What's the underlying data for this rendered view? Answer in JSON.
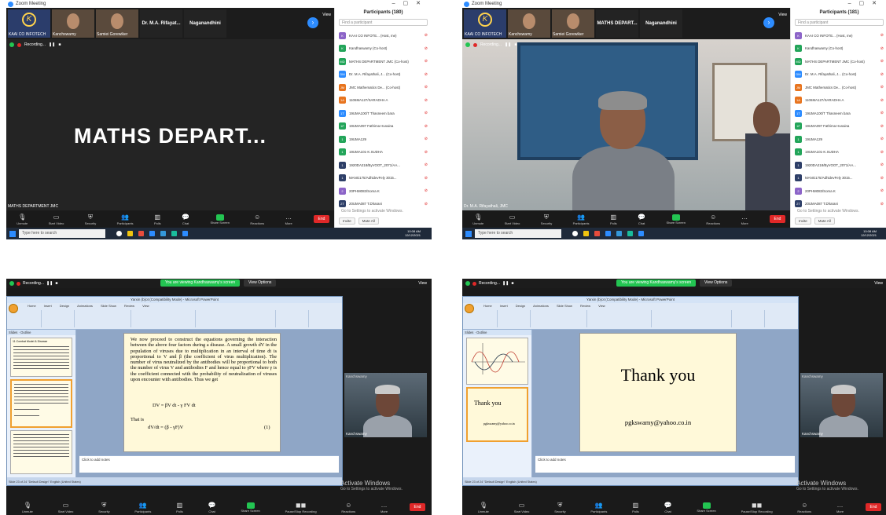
{
  "window_title": "Zoom Meeting",
  "participant_strip": {
    "tiles": [
      "KAAI CO INFOTECH",
      "Kanchswamy",
      "Samiei Gorewiker",
      "Dr. M.A. Rifayat...",
      "Naganandhini"
    ],
    "tiles_q2": [
      "KAAI CO INFOTECH",
      "Kanchswamy",
      "Samiei Gorewiker",
      "MATHS DEPART...",
      "Naganandhini"
    ]
  },
  "view_label": "View",
  "recording_label": "Recording...",
  "active_speaker_name": "MATHS DEPART...",
  "q1_speaker_label": "MATHS DEPARTMENT JMC",
  "q2_speaker_label": "Dr. M.A. Rifayathali, JMC",
  "participants_panel": {
    "title": "Participants (180)",
    "title_q2": "Participants (181)",
    "search_placeholder": "Find a participant",
    "invite": "Invite",
    "mute_all": "Mute All",
    "rows": [
      {
        "initials": "K",
        "name": "KAAI CO INFOTE... (Host, me)",
        "color": "#8c64c8"
      },
      {
        "initials": "K",
        "name": "Kandhaswamy (Co-host)",
        "color": "#23a55a"
      },
      {
        "initials": "MD",
        "name": "MATHS DEPARTMENT JMC (Co-host)",
        "color": "#23a55a"
      },
      {
        "initials": "DM",
        "name": "Dr. M.A. Rifayathali, J... (Co-host)",
        "color": "#2d8cff"
      },
      {
        "initials": "JM",
        "name": "JMC Mathematics De... (Co-host)",
        "color": "#e8741e"
      },
      {
        "initials": "1A",
        "name": "1106MA127/SARADHA A",
        "color": "#e8741e"
      },
      {
        "initials": "1T",
        "name": "19UMA100/T Thasneem bara",
        "color": "#2d8cff"
      },
      {
        "initials": "1F",
        "name": "19UMA097 Fathima Husaina",
        "color": "#23a55a"
      },
      {
        "initials": "1",
        "name": "19UMA129",
        "color": "#23a55a"
      },
      {
        "initials": "1",
        "name": "19UMA101-K.SUDHA",
        "color": "#23a55a"
      },
      {
        "initials": "1",
        "name": "1920DA218/ByVOOT_2071/AA...",
        "color": "#2e3f68"
      },
      {
        "initials": "1",
        "name": "MANG175/AdhidevFely 3015...",
        "color": "#2e3f68"
      },
      {
        "initials": "2",
        "name": "20PHM083/Soma K",
        "color": "#8c64c8"
      },
      {
        "initials": "2T",
        "name": "20UMA087 T.Dharani",
        "color": "#2e3f68"
      }
    ]
  },
  "activate_windows": "Go to Settings to activate Windows.",
  "activate_title": "Activate Windows",
  "controls": {
    "unmute": "Unmute",
    "start_video": "Start Video",
    "security": "Security",
    "participants": "Participants",
    "participants_count": "180",
    "polls": "Polls",
    "chat": "Chat",
    "share_screen": "Share Screen",
    "pause_recording": "Pause/Stop Recording",
    "reactions": "Reactions",
    "more": "More",
    "end": "End"
  },
  "taskbar": {
    "search_placeholder": "Type here to search",
    "time": "10:08 AM",
    "date": "12/12/2021",
    "lang": "ENG"
  },
  "share": {
    "banner": "You are viewing Kandhaswamy's screen",
    "view_options": "View Options",
    "ppt_title": "Yarxin (b)ot (Compatibility Mode) - Microsoft PowerPoint",
    "ribbon_tabs": [
      "Home",
      "Insert",
      "Design",
      "Animations",
      "Slide Show",
      "Review",
      "View"
    ],
    "slides_tab": "Slides",
    "outline_tab": "Outline",
    "notes_placeholder": "Click to add notes",
    "status": "Slide 23 of 24   \"Default Design\"   English (United States)",
    "slide_text": "We now proceed to construct the equations governing the interaction between the above four factors during a disease. A small growth dV in the population of viruses due to multiplication in an interval of time dt is proportional to V and β (the coefficient of virus multiplication). The number of virus neutralized by the antibodies will be proportional to both the number of virus V and antibodies F and hence equal to γFV where γ is the coefficient connected with the probability of neutralization of viruses upon encounter with antibodies. Thus we get",
    "equation_1": "DV = βV dt - γ FV dt",
    "that_is": "That is",
    "equation_2": "dV/dt = (β - γF)V",
    "equation_num": "(1)",
    "thumb_title": "11.Combat Model & Disease",
    "thank_you": "Thank you",
    "email": "pgkswamy@yahoo.co.in",
    "cam_name": "Kanchswamy",
    "cam_tag": "Kanchswamy"
  }
}
